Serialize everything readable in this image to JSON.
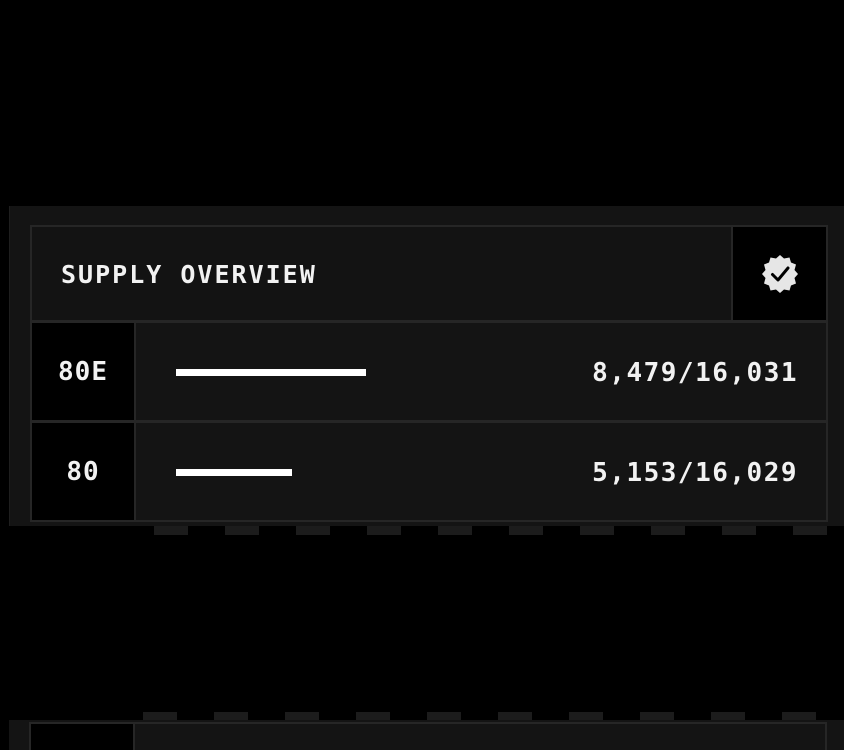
{
  "panel": {
    "title": "SUPPLY OVERVIEW",
    "badge_icon": "verified-check-icon",
    "rows": [
      {
        "label": "80E",
        "value": "8,479/16,031",
        "progress": 0.529,
        "bar_color": "#ffffff"
      },
      {
        "label": "80",
        "value": "5,153/16,029",
        "progress": 0.321,
        "bar_color": "#ffffff"
      }
    ]
  },
  "colors": {
    "background": "#000000",
    "panel": "#141414",
    "border": "#262626",
    "text": "#f2f2f2"
  }
}
